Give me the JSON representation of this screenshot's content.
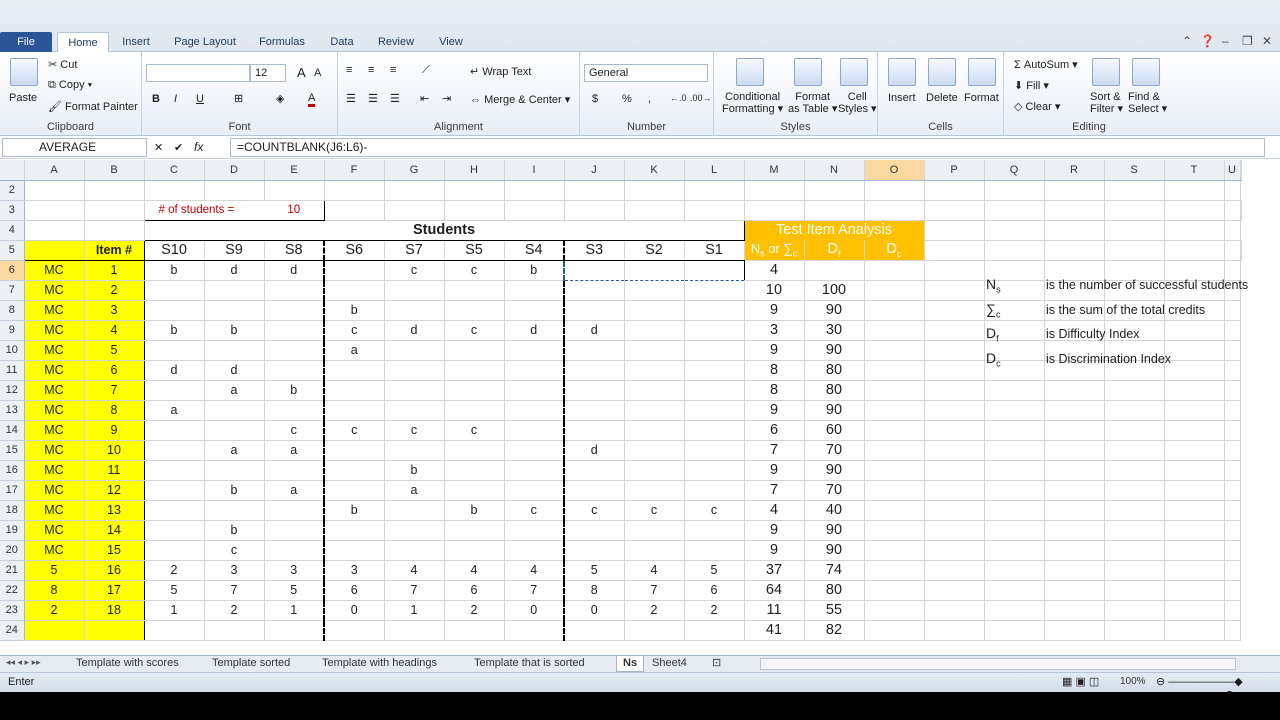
{
  "ribbon_tabs": [
    "File",
    "Home",
    "Insert",
    "Page Layout",
    "Formulas",
    "Data",
    "Review",
    "View"
  ],
  "ribbon": {
    "clipboard": {
      "paste": "Paste",
      "cut": "Cut",
      "copy": "Copy",
      "format_painter": "Format Painter",
      "label": "Clipboard"
    },
    "font": {
      "size": "12",
      "bold": "B",
      "italic": "I",
      "underline": "U",
      "label": "Font"
    },
    "alignment": {
      "wrap": "Wrap Text",
      "merge": "Merge & Center",
      "label": "Alignment"
    },
    "number": {
      "format": "General",
      "currency": "$",
      "percent": "%",
      "comma": ",",
      "label": "Number"
    },
    "styles": {
      "conditional": "Conditional",
      "conditional2": "Formatting",
      "table": "Format",
      "table2": "as Table",
      "cell": "Cell",
      "cell2": "Styles",
      "label": "Styles"
    },
    "cells": {
      "insert": "Insert",
      "delete": "Delete",
      "format": "Format",
      "label": "Cells"
    },
    "editing": {
      "autosum": "AutoSum",
      "fill": "Fill",
      "clear": "Clear",
      "sort": "Sort &",
      "sort2": "Filter",
      "find": "Find &",
      "find2": "Select",
      "label": "Editing"
    }
  },
  "formula_bar": {
    "name_box": "AVERAGE",
    "formula": "=COUNTBLANK(J6:L6)-",
    "fx": "fx"
  },
  "columns": [
    "A",
    "B",
    "C",
    "D",
    "E",
    "F",
    "G",
    "H",
    "I",
    "J",
    "K",
    "L",
    "M",
    "N",
    "O",
    "P",
    "Q",
    "R",
    "S",
    "T",
    "U"
  ],
  "cells": {
    "num_students_label": "# of students =",
    "num_students": "10",
    "students_header": "Students",
    "test_item_analysis": "Test Item Analysis",
    "item_header": "Item #",
    "student_cols": [
      "S10",
      "S9",
      "S8",
      "S6",
      "S7",
      "S5",
      "S4",
      "S3",
      "S2",
      "S1"
    ],
    "ns_header": "N",
    "ns_sub": "s",
    "ns_or": " or ∑",
    "ns_c": "c",
    "df_header": "D",
    "df_sub": "f",
    "dc_header": "D",
    "dc_sub": "c",
    "editing_formula": "=COUNTBLANK(",
    "editing_ref": "J6:L6",
    "editing_tail": ")-",
    "legend": [
      {
        "sym": "N",
        "sub": "s",
        "text": "is the number of successful students"
      },
      {
        "sym": "∑",
        "sub": "c",
        "text": "is the sum of the total credits"
      },
      {
        "sym": "D",
        "sub": "f",
        "text": "is Difficulty Index"
      },
      {
        "sym": "D",
        "sub": "c",
        "text": "is Discrimination Index"
      }
    ]
  },
  "rows": [
    {
      "r": "6",
      "a": "MC",
      "b": "1",
      "s": [
        "b",
        "d",
        "d",
        "",
        "c",
        "c",
        "b",
        "",
        "",
        ""
      ],
      "m": "4",
      "n": ""
    },
    {
      "r": "7",
      "a": "MC",
      "b": "2",
      "s": [
        "",
        "",
        "",
        "",
        "",
        "",
        "",
        "",
        "",
        ""
      ],
      "m": "10",
      "n": "100"
    },
    {
      "r": "8",
      "a": "MC",
      "b": "3",
      "s": [
        "",
        "",
        "",
        "b",
        "",
        "",
        "",
        "",
        "",
        ""
      ],
      "m": "9",
      "n": "90"
    },
    {
      "r": "9",
      "a": "MC",
      "b": "4",
      "s": [
        "b",
        "b",
        "",
        "c",
        "d",
        "c",
        "d",
        "d",
        "",
        ""
      ],
      "m": "3",
      "n": "30"
    },
    {
      "r": "10",
      "a": "MC",
      "b": "5",
      "s": [
        "",
        "",
        "",
        "a",
        "",
        "",
        "",
        "",
        "",
        ""
      ],
      "m": "9",
      "n": "90"
    },
    {
      "r": "11",
      "a": "MC",
      "b": "6",
      "s": [
        "d",
        "d",
        "",
        "",
        "",
        "",
        "",
        "",
        "",
        ""
      ],
      "m": "8",
      "n": "80"
    },
    {
      "r": "12",
      "a": "MC",
      "b": "7",
      "s": [
        "",
        "a",
        "b",
        "",
        "",
        "",
        "",
        "",
        "",
        ""
      ],
      "m": "8",
      "n": "80"
    },
    {
      "r": "13",
      "a": "MC",
      "b": "8",
      "s": [
        "a",
        "",
        "",
        "",
        "",
        "",
        "",
        "",
        "",
        ""
      ],
      "m": "9",
      "n": "90"
    },
    {
      "r": "14",
      "a": "MC",
      "b": "9",
      "s": [
        "",
        "",
        "c",
        "c",
        "c",
        "c",
        "",
        "",
        "",
        ""
      ],
      "m": "6",
      "n": "60"
    },
    {
      "r": "15",
      "a": "MC",
      "b": "10",
      "s": [
        "",
        "a",
        "a",
        "",
        "",
        "",
        "",
        "d",
        "",
        ""
      ],
      "m": "7",
      "n": "70"
    },
    {
      "r": "16",
      "a": "MC",
      "b": "11",
      "s": [
        "",
        "",
        "",
        "",
        "b",
        "",
        "",
        "",
        "",
        ""
      ],
      "m": "9",
      "n": "90"
    },
    {
      "r": "17",
      "a": "MC",
      "b": "12",
      "s": [
        "",
        "b",
        "a",
        "",
        "a",
        "",
        "",
        "",
        "",
        ""
      ],
      "m": "7",
      "n": "70"
    },
    {
      "r": "18",
      "a": "MC",
      "b": "13",
      "s": [
        "",
        "",
        "",
        "b",
        "",
        "b",
        "c",
        "c",
        "c",
        "c"
      ],
      "m": "4",
      "n": "40"
    },
    {
      "r": "19",
      "a": "MC",
      "b": "14",
      "s": [
        "",
        "b",
        "",
        "",
        "",
        "",
        "",
        "",
        "",
        ""
      ],
      "m": "9",
      "n": "90"
    },
    {
      "r": "20",
      "a": "MC",
      "b": "15",
      "s": [
        "",
        "c",
        "",
        "",
        "",
        "",
        "",
        "",
        "",
        ""
      ],
      "m": "9",
      "n": "90"
    },
    {
      "r": "21",
      "a": "5",
      "b": "16",
      "s": [
        "2",
        "3",
        "3",
        "3",
        "4",
        "4",
        "4",
        "5",
        "4",
        "5"
      ],
      "m": "37",
      "n": "74"
    },
    {
      "r": "22",
      "a": "8",
      "b": "17",
      "s": [
        "5",
        "7",
        "5",
        "6",
        "7",
        "6",
        "7",
        "8",
        "7",
        "6"
      ],
      "m": "64",
      "n": "80"
    },
    {
      "r": "23",
      "a": "2",
      "b": "18",
      "s": [
        "1",
        "2",
        "1",
        "0",
        "1",
        "2",
        "0",
        "0",
        "2",
        "2"
      ],
      "m": "11",
      "n": "55"
    },
    {
      "r": "24",
      "a": "",
      "b": "",
      "s": [
        "",
        "",
        "",
        "",
        "",
        "",
        "",
        "",
        "",
        ""
      ],
      "m": "41",
      "n": "82"
    }
  ],
  "sheet_tabs": [
    "Template with scores",
    "Template sorted",
    "Template with headings",
    "Template that is sorted",
    "Ns",
    "Sheet4"
  ],
  "active_sheet": "Ns",
  "status": {
    "mode": "Enter",
    "zoom": "100%"
  }
}
